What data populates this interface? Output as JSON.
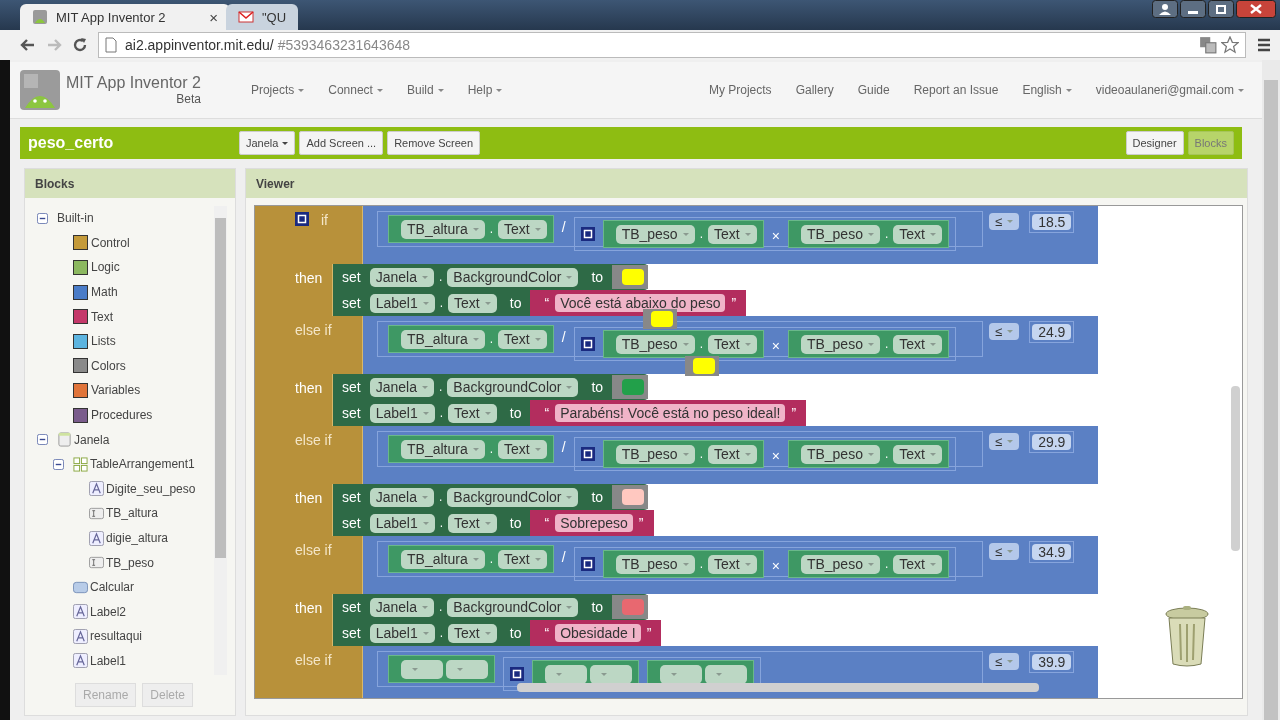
{
  "browser": {
    "tabs": [
      {
        "title": "MIT App Inventor 2",
        "selected": true,
        "close": "×"
      },
      {
        "title": "\"QU",
        "selected": false
      }
    ],
    "url": {
      "host": "ai2.appinventor.mit.edu/",
      "path": "#5393463231643648"
    }
  },
  "app": {
    "name": "MIT App Inventor 2",
    "edition": "Beta",
    "menus": [
      {
        "label": "Projects",
        "dropdown": true
      },
      {
        "label": "Connect",
        "dropdown": true
      },
      {
        "label": "Build",
        "dropdown": true
      },
      {
        "label": "Help",
        "dropdown": true
      }
    ],
    "links": [
      {
        "label": "My Projects",
        "dropdown": false
      },
      {
        "label": "Gallery",
        "dropdown": false
      },
      {
        "label": "Guide",
        "dropdown": false
      },
      {
        "label": "Report an Issue",
        "dropdown": false
      },
      {
        "label": "English",
        "dropdown": true
      },
      {
        "label": "videoaulaneri@gmail.com",
        "dropdown": true
      }
    ]
  },
  "project_bar": {
    "project": "peso_certo",
    "screen": "Janela",
    "buttons": [
      "Add Screen ...",
      "Remove Screen"
    ],
    "views": [
      {
        "label": "Designer",
        "selected": false
      },
      {
        "label": "Blocks",
        "selected": true
      }
    ]
  },
  "blocks_panel": {
    "title": "Blocks",
    "tree": [
      {
        "label": "Built-in",
        "kind": "group",
        "expanded": true,
        "children": [
          {
            "label": "Control",
            "kind": "category",
            "color": "#c49a3a"
          },
          {
            "label": "Logic",
            "kind": "category",
            "color": "#8cb860"
          },
          {
            "label": "Math",
            "kind": "category",
            "color": "#4a7cc8"
          },
          {
            "label": "Text",
            "kind": "category",
            "color": "#c4386a"
          },
          {
            "label": "Lists",
            "kind": "category",
            "color": "#5cb4e0"
          },
          {
            "label": "Colors",
            "kind": "category",
            "color": "#8a8a8a"
          },
          {
            "label": "Variables",
            "kind": "category",
            "color": "#e0743a"
          },
          {
            "label": "Procedures",
            "kind": "category",
            "color": "#7a5c8c"
          }
        ]
      },
      {
        "label": "Janela",
        "kind": "screen",
        "expanded": true,
        "children": [
          {
            "label": "TableArrangement1",
            "kind": "table",
            "expanded": true,
            "children": [
              {
                "label": "Digite_seu_peso",
                "kind": "label"
              },
              {
                "label": "TB_altura",
                "kind": "textbox"
              },
              {
                "label": "digie_altura",
                "kind": "label"
              },
              {
                "label": "TB_peso",
                "kind": "textbox"
              }
            ]
          },
          {
            "label": "Calcular",
            "kind": "button"
          },
          {
            "label": "Label2",
            "kind": "label"
          },
          {
            "label": "resultaqui",
            "kind": "label"
          },
          {
            "label": "Label1",
            "kind": "label"
          }
        ]
      }
    ],
    "buttons": [
      {
        "label": "Rename",
        "disabled": true
      },
      {
        "label": "Delete",
        "disabled": true
      }
    ]
  },
  "viewer": {
    "title": "Viewer",
    "branches": [
      {
        "kind": "if",
        "keyword": "if",
        "left": {
          "component": "TB_altura",
          "dot": ".",
          "property": "Text"
        },
        "divide": "/",
        "factor_a": {
          "component": "TB_peso",
          "dot": ".",
          "property": "Text"
        },
        "times": "×",
        "factor_b": {
          "component": "TB_peso",
          "dot": ".",
          "property": "Text"
        },
        "compare": "≤",
        "threshold": "18.5",
        "then": "then",
        "color_set": {
          "verb": "set",
          "component": "Janela",
          "dot": ".",
          "property": "BackgroundColor",
          "to": "to",
          "color": "#ffff00"
        },
        "text_set": {
          "verb": "set",
          "component": "Label1",
          "dot": ".",
          "property": "Text",
          "to": "to",
          "open_quote": "“",
          "text": "Você está abaixo do peso",
          "close_quote": "”"
        }
      },
      {
        "kind": "else_if",
        "keyword": "else if",
        "left": {
          "component": "TB_altura",
          "dot": ".",
          "property": "Text"
        },
        "divide": "/",
        "factor_a": {
          "component": "TB_peso",
          "dot": ".",
          "property": "Text"
        },
        "times": "×",
        "factor_b": {
          "component": "TB_peso",
          "dot": ".",
          "property": "Text"
        },
        "compare": "≤",
        "threshold": "24.9",
        "then": "then",
        "color_set": {
          "verb": "set",
          "component": "Janela",
          "dot": ".",
          "property": "BackgroundColor",
          "to": "to",
          "color": "#22a04a"
        },
        "text_set": {
          "verb": "set",
          "component": "Label1",
          "dot": ".",
          "property": "Text",
          "to": "to",
          "open_quote": "“",
          "text": "Parabéns! Você está no peso ideal!",
          "close_quote": "”"
        }
      },
      {
        "kind": "else_if",
        "keyword": "else if",
        "left": {
          "component": "TB_altura",
          "dot": ".",
          "property": "Text"
        },
        "divide": "/",
        "factor_a": {
          "component": "TB_peso",
          "dot": ".",
          "property": "Text"
        },
        "times": "×",
        "factor_b": {
          "component": "TB_peso",
          "dot": ".",
          "property": "Text"
        },
        "compare": "≤",
        "threshold": "29.9",
        "then": "then",
        "color_set": {
          "verb": "set",
          "component": "Janela",
          "dot": ".",
          "property": "BackgroundColor",
          "to": "to",
          "color": "#ffc8c0"
        },
        "text_set": {
          "verb": "set",
          "component": "Label1",
          "dot": ".",
          "property": "Text",
          "to": "to",
          "open_quote": "“",
          "text": "Sobrepeso",
          "close_quote": "”"
        }
      },
      {
        "kind": "else_if",
        "keyword": "else if",
        "left": {
          "component": "TB_altura",
          "dot": ".",
          "property": "Text"
        },
        "divide": "/",
        "factor_a": {
          "component": "TB_peso",
          "dot": ".",
          "property": "Text"
        },
        "times": "×",
        "factor_b": {
          "component": "TB_peso",
          "dot": ".",
          "property": "Text"
        },
        "compare": "≤",
        "threshold": "34.9",
        "then": "then",
        "color_set": {
          "verb": "set",
          "component": "Janela",
          "dot": ".",
          "property": "BackgroundColor",
          "to": "to",
          "color": "#e86870"
        },
        "text_set": {
          "verb": "set",
          "component": "Label1",
          "dot": ".",
          "property": "Text",
          "to": "to",
          "open_quote": "“",
          "text": "Obesidade I",
          "close_quote": "”"
        }
      },
      {
        "kind": "partial",
        "keyword": "else if",
        "compare": "≤",
        "threshold": "39.9"
      }
    ],
    "loose_blocks": [
      {
        "color": "#ffff00"
      },
      {
        "color": "#ffff00"
      }
    ]
  }
}
